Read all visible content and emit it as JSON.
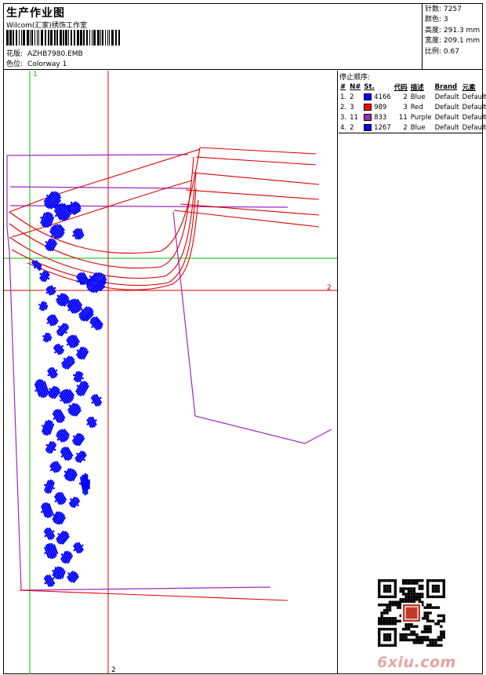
{
  "header": {
    "title": "生产作业图",
    "company": "Wilcom(汇家)绣饰工作室",
    "design_label": "花版:",
    "design_value": "AZHB7980.EMB",
    "colorway_label": "色位:",
    "colorway_value": "Colorway 1"
  },
  "stats": [
    {
      "label": "针数:",
      "value": "7257"
    },
    {
      "label": "颜色:",
      "value": "3"
    },
    {
      "label": "高度:",
      "value": "291.3 mm"
    },
    {
      "label": "宽度:",
      "value": "209.1 mm"
    },
    {
      "label": "比例:",
      "value": "0.67"
    }
  ],
  "guides": {
    "green_top": "1",
    "red_right": "2",
    "red_bottom": "2"
  },
  "stop_sequence": {
    "title": "停止顺序:",
    "columns": [
      "#",
      "N#",
      "St.",
      "代码",
      "描述",
      "Brand",
      "元素"
    ],
    "rows": [
      {
        "idx": "1.",
        "n": "2",
        "color": "#0000ff",
        "st": "4166",
        "code": "2",
        "desc": "Blue",
        "brand": "Default"
      },
      {
        "idx": "2.",
        "n": "3",
        "color": "#ff0000",
        "st": "989",
        "code": "3",
        "desc": "Red",
        "brand": "Default"
      },
      {
        "idx": "3.",
        "n": "11",
        "color": "#9d27c4",
        "st": "833",
        "code": "11",
        "desc": "Purple",
        "brand": "Default"
      },
      {
        "idx": "4.",
        "n": "2",
        "color": "#0000ff",
        "st": "1267",
        "code": "2",
        "desc": "Blue",
        "brand": "Default"
      }
    ]
  },
  "watermark": {
    "logo_main": "6xiu",
    "logo_tld": ".com"
  },
  "colors": {
    "blue": "#0000ff",
    "red": "#e00000",
    "purple": "#9d27c4",
    "green": "#00c000"
  }
}
